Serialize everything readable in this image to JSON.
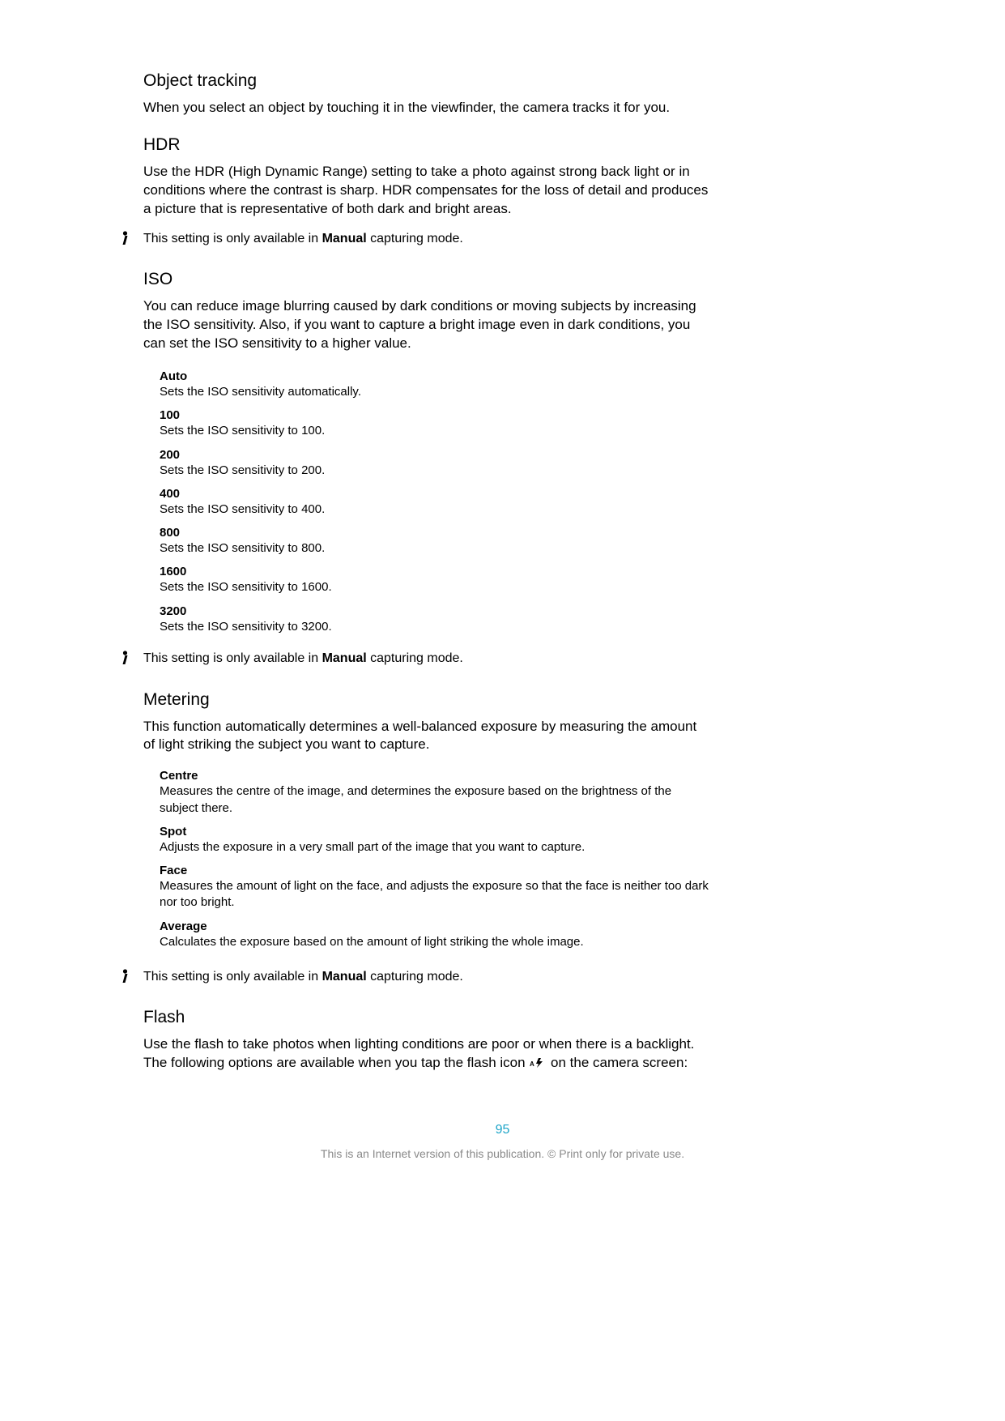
{
  "sections": {
    "object_tracking": {
      "heading": "Object tracking",
      "body": "When you select an object by touching it in the viewfinder, the camera tracks it for you."
    },
    "hdr": {
      "heading": "HDR",
      "body": "Use the HDR (High Dynamic Range) setting to take a photo against strong back light or in conditions where the contrast is sharp. HDR compensates for the loss of detail and produces a picture that is representative of both dark and bright areas.",
      "note_pre": "This setting is only available in ",
      "note_bold": "Manual",
      "note_post": " capturing mode."
    },
    "iso": {
      "heading": "ISO",
      "body": "You can reduce image blurring caused by dark conditions or moving subjects by increasing the ISO sensitivity. Also, if you want to capture a bright image even in dark conditions, you can set the ISO sensitivity to a higher value.",
      "options": [
        {
          "title": "Auto",
          "desc": "Sets the ISO sensitivity automatically."
        },
        {
          "title": "100",
          "desc": "Sets the ISO sensitivity to 100."
        },
        {
          "title": "200",
          "desc": "Sets the ISO sensitivity to 200."
        },
        {
          "title": "400",
          "desc": "Sets the ISO sensitivity to 400."
        },
        {
          "title": "800",
          "desc": "Sets the ISO sensitivity to 800."
        },
        {
          "title": "1600",
          "desc": "Sets the ISO sensitivity to 1600."
        },
        {
          "title": "3200",
          "desc": "Sets the ISO sensitivity to 3200."
        }
      ],
      "note_pre": "This setting is only available in ",
      "note_bold": "Manual",
      "note_post": " capturing mode."
    },
    "metering": {
      "heading": "Metering",
      "body": "This function automatically determines a well-balanced exposure by measuring the amount of light striking the subject you want to capture.",
      "options": [
        {
          "title": "Centre",
          "desc": "Measures the centre of the image, and determines the exposure based on the brightness of the subject there."
        },
        {
          "title": "Spot",
          "desc": "Adjusts the exposure in a very small part of the image that you want to capture."
        },
        {
          "title": "Face",
          "desc": "Measures the amount of light on the face, and adjusts the exposure so that the face is neither too dark nor too bright."
        },
        {
          "title": "Average",
          "desc": "Calculates the exposure based on the amount of light striking the whole image."
        }
      ],
      "note_pre": "This setting is only available in ",
      "note_bold": "Manual",
      "note_post": " capturing mode."
    },
    "flash": {
      "heading": "Flash",
      "body_pre": "Use the flash to take photos when lighting conditions are poor or when there is a backlight. The following options are available when you tap the flash icon ",
      "body_post": " on the camera screen:"
    }
  },
  "page_number": "95",
  "footer": "This is an Internet version of this publication. © Print only for private use."
}
